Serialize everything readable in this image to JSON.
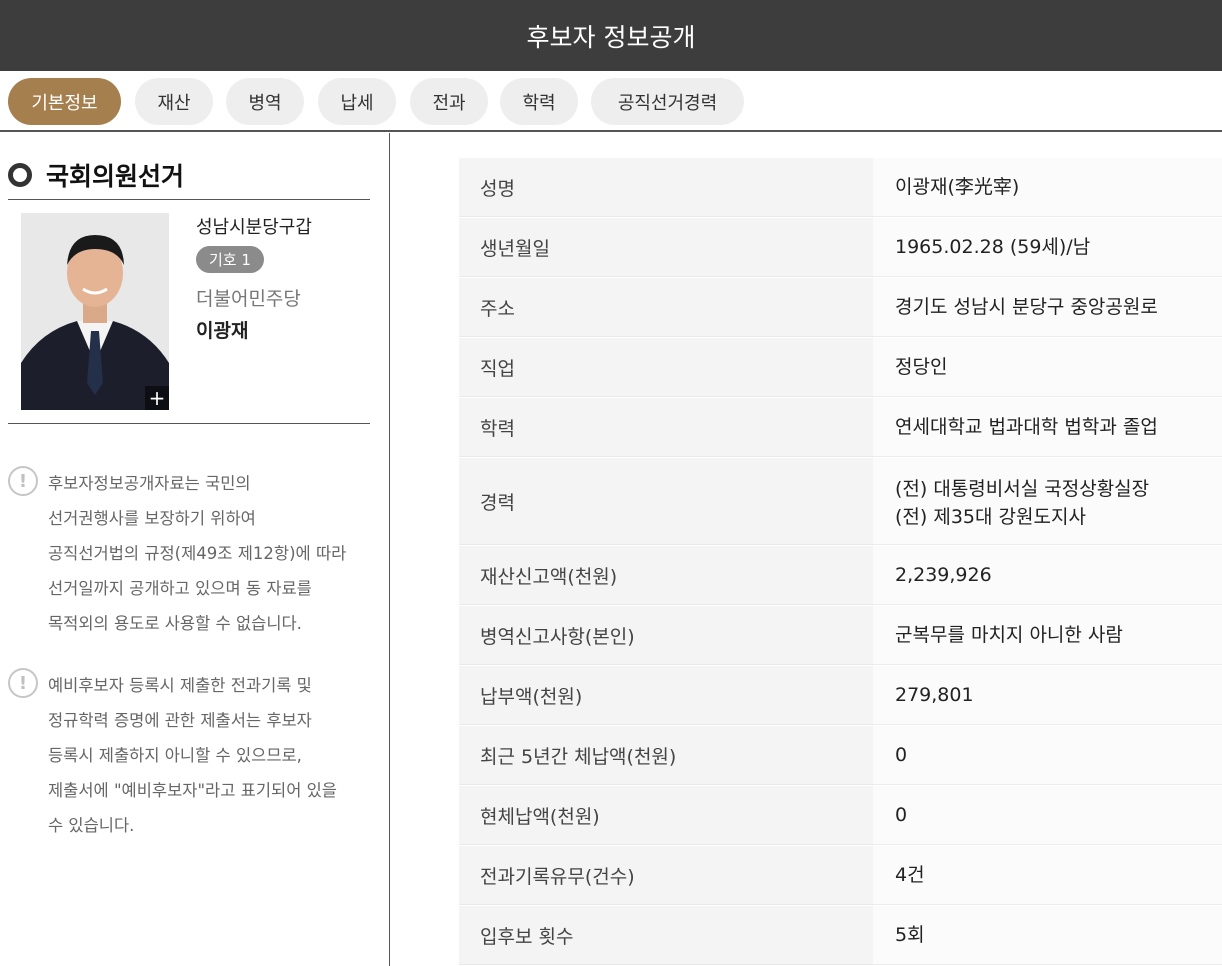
{
  "header": {
    "title": "후보자 정보공개"
  },
  "tabs": [
    {
      "label": "기본정보",
      "active": true
    },
    {
      "label": "재산"
    },
    {
      "label": "병역"
    },
    {
      "label": "납세"
    },
    {
      "label": "전과"
    },
    {
      "label": "학력"
    },
    {
      "label": "공직선거경력"
    }
  ],
  "sidebar": {
    "section_title": "국회의원선거",
    "district": "성남시분당구갑",
    "number_badge": "기호 1",
    "party": "더불어민주당",
    "candidate_name": "이광재",
    "photo_zoom_label": "+",
    "notices": [
      {
        "icon": "!",
        "text": "후보자정보공개자료는 국민의\n선거권행사를 보장하기 위하여\n공직선거법의 규정(제49조 제12항)에 따라\n선거일까지 공개하고 있으며 동 자료를\n목적외의 용도로 사용할 수 없습니다."
      },
      {
        "icon": "!",
        "text": "예비후보자 등록시 제출한 전과기록 및\n정규학력 증명에 관한 제출서는 후보자\n등록시 제출하지 아니할 수 있으므로,\n제출서에 \"예비후보자\"라고 표기되어 있을\n수 있습니다."
      }
    ]
  },
  "info_table": [
    {
      "label": "성명",
      "value": "이광재(李光宰)"
    },
    {
      "label": "생년월일",
      "value": "1965.02.28 (59세)/남"
    },
    {
      "label": "주소",
      "value": "경기도 성남시 분당구 중앙공원로"
    },
    {
      "label": "직업",
      "value": "정당인"
    },
    {
      "label": "학력",
      "value": "연세대학교 법과대학 법학과 졸업"
    },
    {
      "label": "경력",
      "value": "(전) 대통령비서실 국정상황실장\n(전) 제35대 강원도지사"
    },
    {
      "label": "재산신고액(천원)",
      "value": "2,239,926"
    },
    {
      "label": "병역신고사항(본인)",
      "value": "군복무를 마치지 아니한 사람"
    },
    {
      "label": "납부액(천원)",
      "value": "279,801"
    },
    {
      "label": "최근 5년간 체납액(천원)",
      "value": "0"
    },
    {
      "label": "현체납액(천원)",
      "value": "0"
    },
    {
      "label": "전과기록유무(건수)",
      "value": "4건"
    },
    {
      "label": "입후보 횟수",
      "value": "5회"
    }
  ],
  "colors": {
    "header_bg": "#3d3d3d",
    "active_tab": "#a57f4e",
    "badge": "#8b8b8b"
  }
}
